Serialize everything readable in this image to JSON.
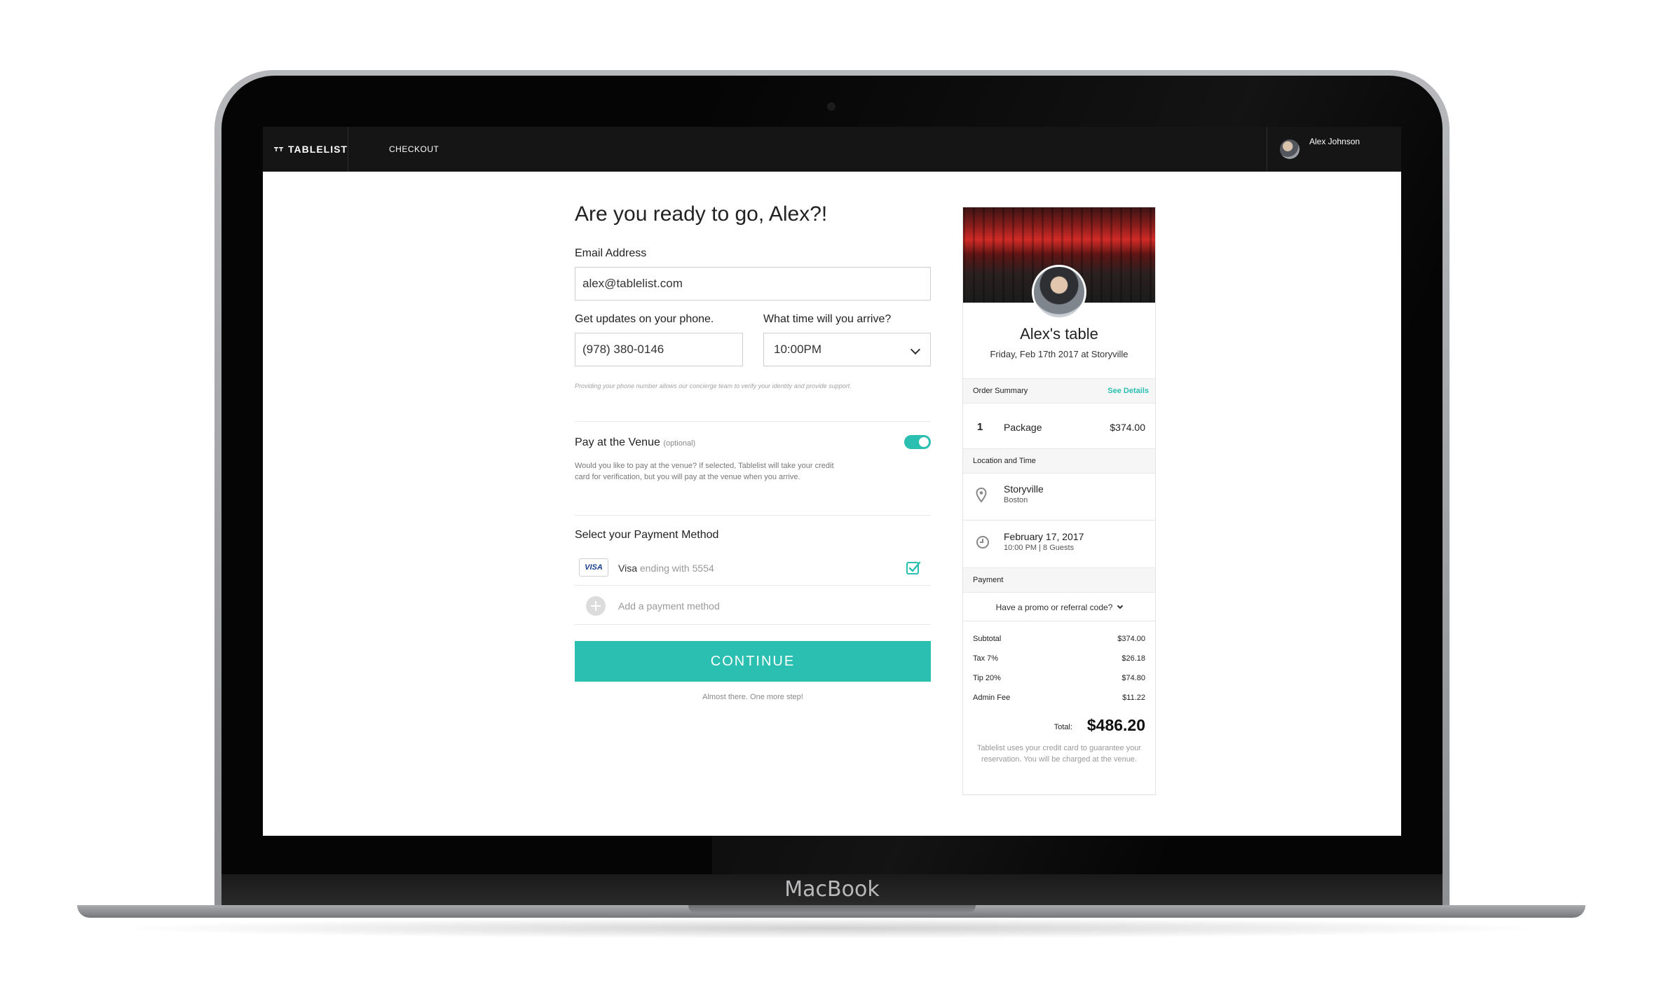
{
  "device": {
    "label": "MacBook"
  },
  "topbar": {
    "brand": "TABLELIST",
    "nav": "CHECKOUT",
    "user_name": "Alex Johnson"
  },
  "form": {
    "heading": "Are you ready to go, Alex?!",
    "email_label": "Email Address",
    "email_value": "alex@tablelist.com",
    "phone_label": "Get updates on your phone.",
    "phone_value": "(978) 380-0146",
    "arrival_label": "What time will you arrive?",
    "arrival_value": "10:00PM",
    "phone_hint": "Providing your phone number allows our concierge team to verify your identity and provide support.",
    "pay_venue_title": "Pay at the Venue",
    "pay_venue_optional": "(optional)",
    "pay_venue_enabled": true,
    "pay_venue_desc": "Would you like to pay at the venue? If selected, Tablelist will take your credit card for verification, but you will pay at the venue when you arrive.",
    "payment_method_title": "Select your Payment Method",
    "card_brand_badge": "VISA",
    "card_name": "Visa",
    "card_ending": "ending with 5554",
    "add_payment": "Add a payment method",
    "continue_label": "CONTINUE",
    "almost_text": "Almost there. One more step!",
    "accent_color": "#2bbfb1"
  },
  "summary": {
    "table_title": "Alex's table",
    "table_sub": "Friday, Feb 17th 2017 at Storyville",
    "order_summary_label": "Order Summary",
    "see_details": "See Details",
    "qty": "1",
    "package": "Package",
    "package_price": "$374.00",
    "location_time_label": "Location and Time",
    "venue_name": "Storyville",
    "venue_city": "Boston",
    "date_main": "February 17, 2017",
    "date_sub": "10:00 PM | 8 Guests",
    "payment_label": "Payment",
    "promo": "Have a promo or referral code?",
    "fees": [
      {
        "label": "Subtotal",
        "value": "$374.00"
      },
      {
        "label": "Tax 7%",
        "value": "$26.18"
      },
      {
        "label": "Tip 20%",
        "value": "$74.80"
      },
      {
        "label": "Admin Fee",
        "value": "$11.22"
      }
    ],
    "total_label": "Total:",
    "total_value": "$486.20",
    "disclaimer": "Tablelist uses your credit card to guarantee your reservation. You will be charged at the venue."
  }
}
